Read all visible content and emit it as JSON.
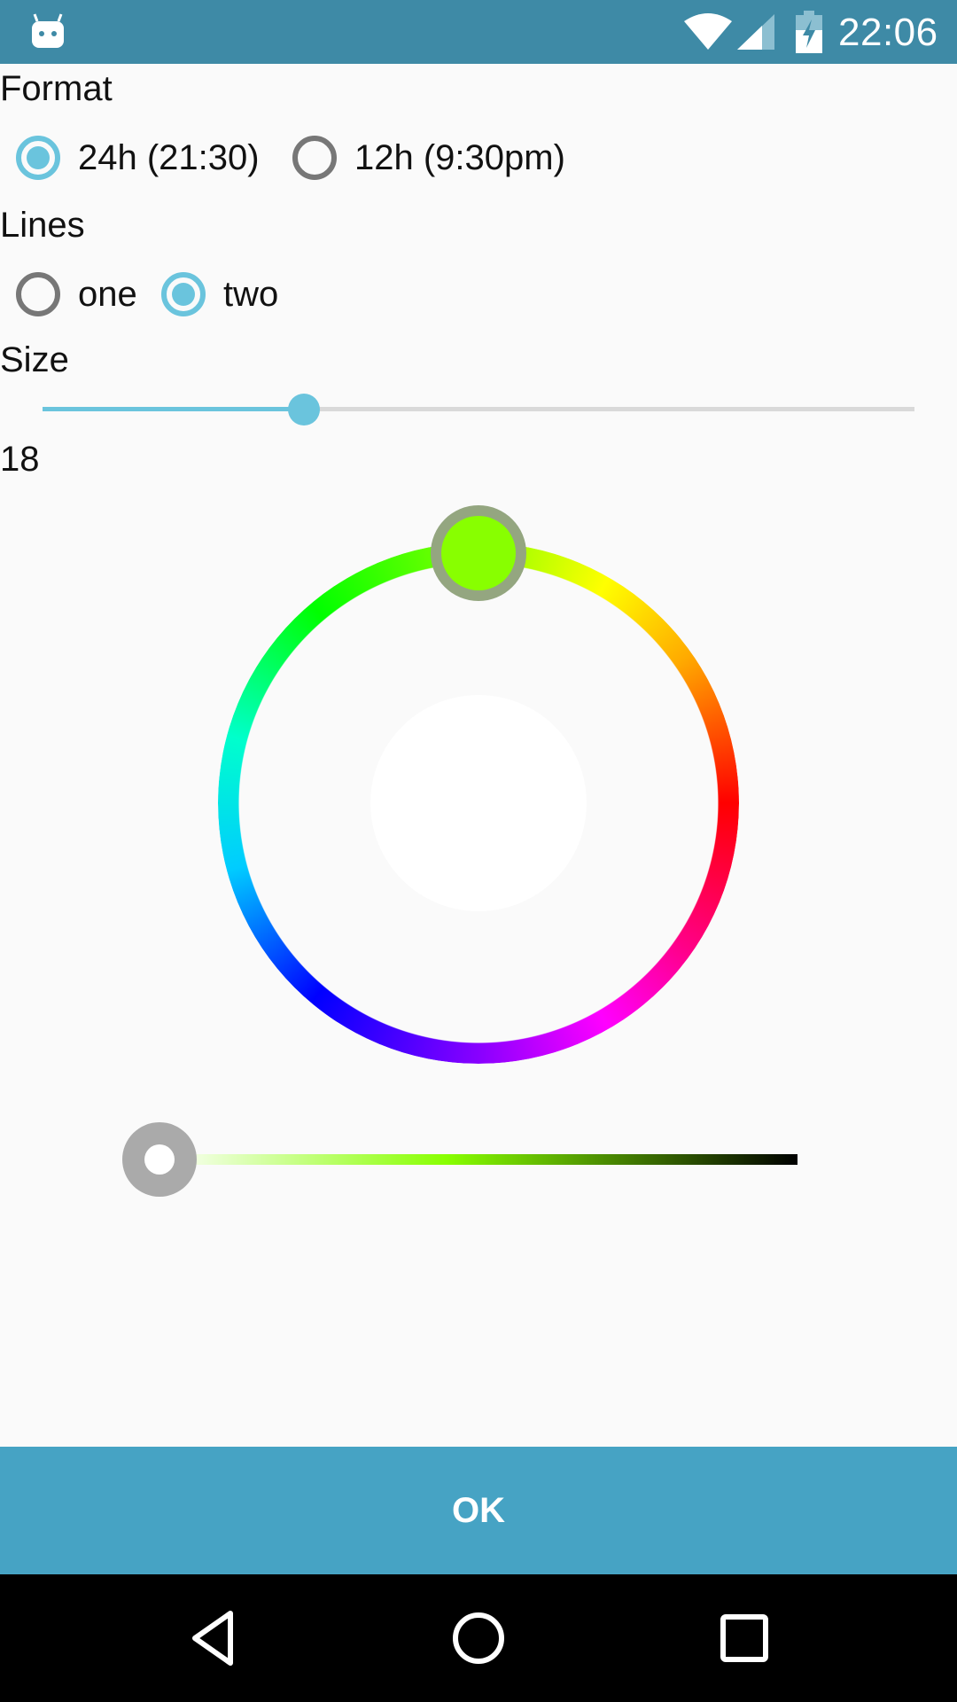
{
  "status_bar": {
    "time": "22:06",
    "icons": [
      "android-app-icon",
      "wifi-icon",
      "signal-icon",
      "battery-charging-icon"
    ],
    "background": "#3e8aa6"
  },
  "format": {
    "label": "Format",
    "options": [
      {
        "label": "24h (21:30)",
        "checked": true
      },
      {
        "label": "12h (9:30pm)",
        "checked": false
      }
    ]
  },
  "lines": {
    "label": "Lines",
    "options": [
      {
        "label": "one",
        "checked": false
      },
      {
        "label": "two",
        "checked": true
      }
    ]
  },
  "size": {
    "label": "Size",
    "value": "18",
    "slider_fraction": 0.3
  },
  "color_picker": {
    "selected_color": "#88ff00",
    "center_color": "#ffffff",
    "value_fraction": 0.0
  },
  "ok_button": {
    "label": "OK",
    "color": "#46a3c4"
  },
  "nav_bar": {
    "buttons": [
      "back-icon",
      "home-icon",
      "recents-icon"
    ]
  },
  "accent_color": "#6ac4dd"
}
